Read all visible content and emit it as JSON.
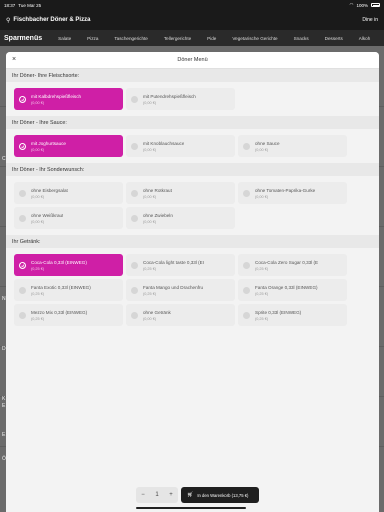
{
  "status_bar": {
    "time": "18:37",
    "date": "Tue Mar 25",
    "battery": "100%"
  },
  "app": {
    "title": "Fischbacher Döner & Pizza",
    "dine_in": "Dine in"
  },
  "categories": [
    {
      "label": "Sparmenüs",
      "active": true
    },
    {
      "label": "Salate"
    },
    {
      "label": "Pizza"
    },
    {
      "label": "Taschengerichte"
    },
    {
      "label": "Tellergerichte"
    },
    {
      "label": "Pide"
    },
    {
      "label": "Vegetarische Gerichte"
    },
    {
      "label": "Snacks"
    },
    {
      "label": "Desserts"
    },
    {
      "label": "Alkoh"
    }
  ],
  "background_letters": [
    "C",
    "N",
    "D",
    "K",
    "E",
    "E",
    "Ö"
  ],
  "modal": {
    "title": "Döner Menü",
    "sections": [
      {
        "title": "Ihr Döner- Ihre Fleischsorte:",
        "options": [
          {
            "name": "mit Kalbdrehspießfleisch",
            "price": "(0,00 €)",
            "selected": true
          },
          {
            "name": "mit Putendrehspießfleisch",
            "price": "(0,00 €)"
          }
        ]
      },
      {
        "title": "Ihr Döner - Ihre Sauce:",
        "options": [
          {
            "name": "mit Joghurtsauce",
            "price": "(0,00 €)",
            "selected": true
          },
          {
            "name": "mit Knoblauchsauce",
            "price": "(0,00 €)"
          },
          {
            "name": "ohne Sauce",
            "price": "(0,00 €)"
          }
        ]
      },
      {
        "title": "Ihr Döner - Ihr Sonderwunsch:",
        "options": [
          {
            "name": "ohne Eisbergsalat",
            "price": "(0,00 €)"
          },
          {
            "name": "ohne Rotkraut",
            "price": "(0,00 €)"
          },
          {
            "name": "ohne Tomaten-Paprika-Gurke",
            "price": "(0,00 €)"
          },
          {
            "name": "ohne Weißkraut",
            "price": "(0,00 €)"
          },
          {
            "name": "ohne Zwiebeln",
            "price": "(0,00 €)"
          }
        ]
      },
      {
        "title": "Ihr Getränk:",
        "options": [
          {
            "name": "Coca-Cola 0,33l (EINWEG)",
            "price": "(0,25 €)",
            "selected": true
          },
          {
            "name": "Coca-Cola light taste 0,33l (EI",
            "price": "(0,25 €)"
          },
          {
            "name": "Coca-Cola Zero Sugar 0,33l (E",
            "price": "(0,25 €)"
          },
          {
            "name": "Fanta Exotic 0,33l (EINWEG)",
            "price": "(0,25 €)"
          },
          {
            "name": "Fanta Mango und Drachenfru",
            "price": "(0,25 €)"
          },
          {
            "name": "Fanta Orange 0,33l (EINWEG)",
            "price": "(0,25 €)"
          },
          {
            "name": "Mezzo Mix 0,33l (EINWEG)",
            "price": "(0,25 €)"
          },
          {
            "name": "ohne Getränk",
            "price": "(0,00 €)"
          },
          {
            "name": "Sprite 0,33l (EINWEG)",
            "price": "(0,25 €)"
          }
        ]
      }
    ]
  },
  "footer": {
    "minus": "−",
    "quantity": "1",
    "plus": "+",
    "cart_label": "In den Warenkorb (13,75 €)"
  },
  "colors": {
    "accent": "#cf1fa6",
    "dark": "#1f1f1f"
  }
}
